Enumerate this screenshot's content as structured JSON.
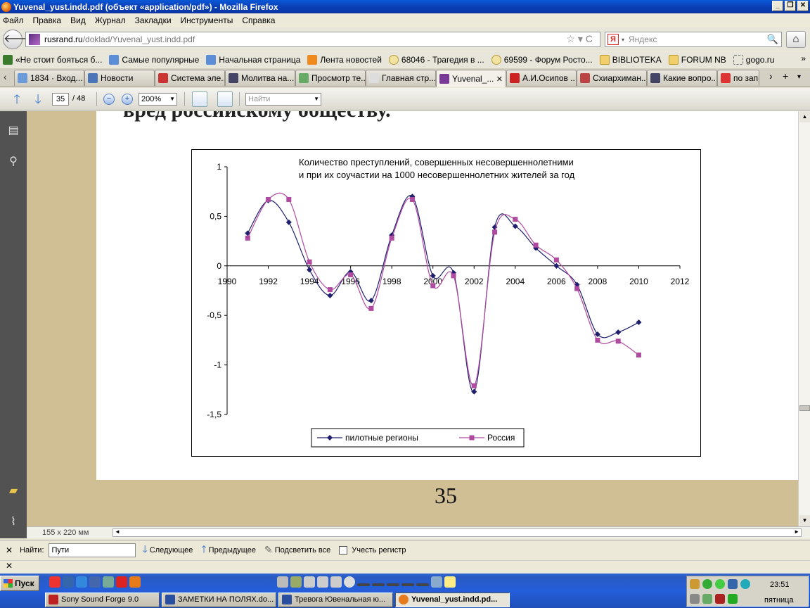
{
  "window": {
    "title": "Yuvenal_yust.indd.pdf (объект «application/pdf») - Mozilla Firefox"
  },
  "menu": [
    "Файл",
    "Правка",
    "Вид",
    "Журнал",
    "Закладки",
    "Инструменты",
    "Справка"
  ],
  "nav": {
    "url_host": "rusrand.ru",
    "url_path": "/doklad/Yuvenal_yust.indd.pdf",
    "search_placeholder": "Яндекс",
    "search_engine_letter": "Я"
  },
  "bookmarks": [
    "«Не стоит бояться б...",
    "Самые популярные",
    "Начальная страница",
    "Лента новостей",
    "68046 - Трагедия в ...",
    "69599 - Форум Росто...",
    "BIBLIOTEKA",
    "FORUM NB",
    "gogo.ru"
  ],
  "tabs": [
    "1834 · Вход...",
    "Новости",
    "Система эле...",
    "Молитва на...",
    "Просмотр те...",
    "Главная стр...",
    "Yuvenal_...",
    "А.И.Осипов ...",
    "Схиархиман...",
    "Какие вопро...",
    "по запро"
  ],
  "pdf_toolbar": {
    "page_current": "35",
    "page_total": "/ 48",
    "zoom": "200%",
    "find_placeholder": "Найти"
  },
  "document": {
    "heading": "вред российскому обществу.",
    "page_number": "35",
    "page_size": "155 x 220 мм"
  },
  "findbar": {
    "label": "Найти:",
    "value": "Пути",
    "next": "Следующее",
    "prev": "Предыдущее",
    "highlight": "Подсветить все",
    "match_case": "Учесть регистр"
  },
  "taskbar": {
    "start": "Пуск",
    "buttons": [
      "Sony Sound Forge 9.0",
      "ЗАМЕТКИ НА ПОЛЯХ.do...",
      "Тревога Ювенальная ю...",
      "Yuvenal_yust.indd.pd..."
    ],
    "clock": "23:51",
    "day": "пятница"
  },
  "chart_data": {
    "type": "line",
    "title": "Количество преступлений, совершенных несовершеннолетними и при их соучастии на 1000 несовершеннолетних жителей за год",
    "title_lines": [
      "Количество преступлений, совершенных несовершеннолетними",
      "и при их соучастии на 1000 несовершеннолетних жителей за год"
    ],
    "x": [
      1991,
      1992,
      1993,
      1994,
      1995,
      1996,
      1997,
      1998,
      1999,
      2000,
      2001,
      2002,
      2003,
      2004,
      2005,
      2006,
      2007,
      2008,
      2009,
      2010
    ],
    "xlim": [
      1990,
      2012
    ],
    "xticks": [
      "1990",
      "1992",
      "1994",
      "1996",
      "1998",
      "2000",
      "2002",
      "2004",
      "2006",
      "2008",
      "2010",
      "2012"
    ],
    "ylim": [
      -1.5,
      1
    ],
    "yticks": [
      "1",
      "0,5",
      "0",
      "-0,5",
      "-1",
      "-1,5"
    ],
    "legend_position": "bottom",
    "series": [
      {
        "name": "пилотные регионы",
        "color": "#1f1f6e",
        "marker": "diamond",
        "values": [
          0.33,
          0.66,
          0.44,
          -0.04,
          -0.3,
          -0.06,
          -0.35,
          0.31,
          0.7,
          -0.1,
          -0.07,
          -1.27,
          0.39,
          0.4,
          0.18,
          0.0,
          -0.19,
          -0.69,
          -0.67,
          -0.57
        ]
      },
      {
        "name": "Россия",
        "color": "#b04aa0",
        "marker": "square",
        "values": [
          0.28,
          0.67,
          0.67,
          0.04,
          -0.24,
          -0.09,
          -0.43,
          0.28,
          0.67,
          -0.2,
          -0.1,
          -1.21,
          0.34,
          0.47,
          0.21,
          0.06,
          -0.23,
          -0.75,
          -0.76,
          -0.9
        ]
      }
    ]
  }
}
